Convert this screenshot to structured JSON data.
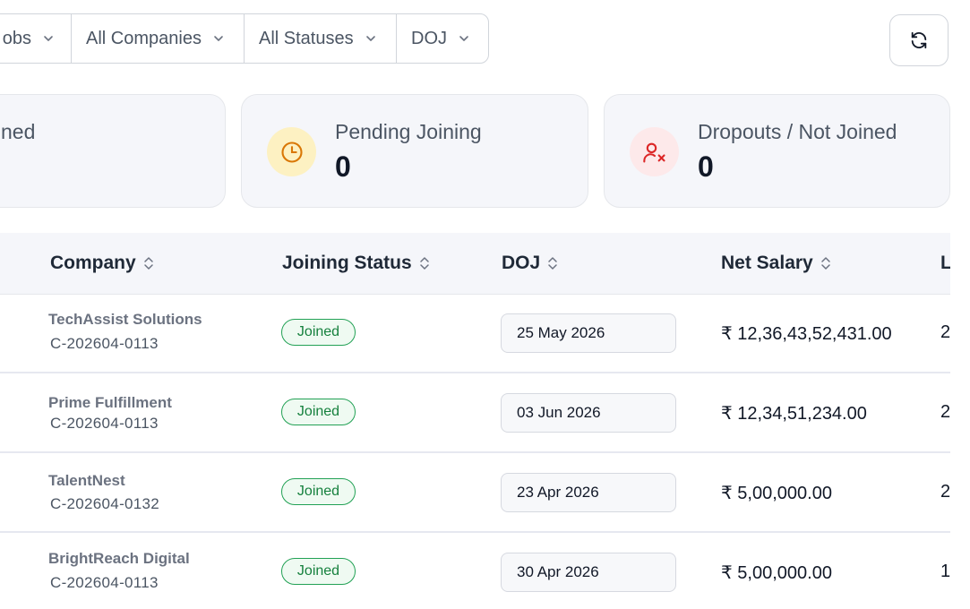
{
  "filters": {
    "jobs": "obs",
    "companies": "All Companies",
    "statuses": "All Statuses",
    "doj": "DOJ"
  },
  "stats": {
    "joined_label": "ned",
    "pending_label": "Pending Joining",
    "pending_count": "0",
    "dropouts_label": "Dropouts / Not Joined",
    "dropouts_count": "0"
  },
  "table": {
    "headers": {
      "company": "Company",
      "joining_status": "Joining Status",
      "doj": "DOJ",
      "net_salary": "Net Salary",
      "next": "L"
    },
    "rows": [
      {
        "company": "TechAssist Solutions",
        "code": "C-202604-0113",
        "status": "Joined",
        "doj": "25 May 2026",
        "salary": "₹ 12,36,43,52,431.00",
        "extra": "2"
      },
      {
        "company": "Prime Fulfillment",
        "code": "C-202604-0113",
        "status": "Joined",
        "doj": "03 Jun 2026",
        "salary": "₹ 12,34,51,234.00",
        "extra": "2"
      },
      {
        "company": "TalentNest",
        "code": "C-202604-0132",
        "status": "Joined",
        "doj": "23 Apr 2026",
        "salary": "₹ 5,00,000.00",
        "extra": "2"
      },
      {
        "company": "BrightReach Digital",
        "code": "C-202604-0113",
        "status": "Joined",
        "doj": "30 Apr 2026",
        "salary": "₹ 5,00,000.00",
        "extra": "1("
      }
    ]
  },
  "colors": {
    "joined_status": "#15803d",
    "pending_icon": "#d97706",
    "dropout_icon": "#dc2626",
    "card_bg": "#f5f6fa"
  }
}
